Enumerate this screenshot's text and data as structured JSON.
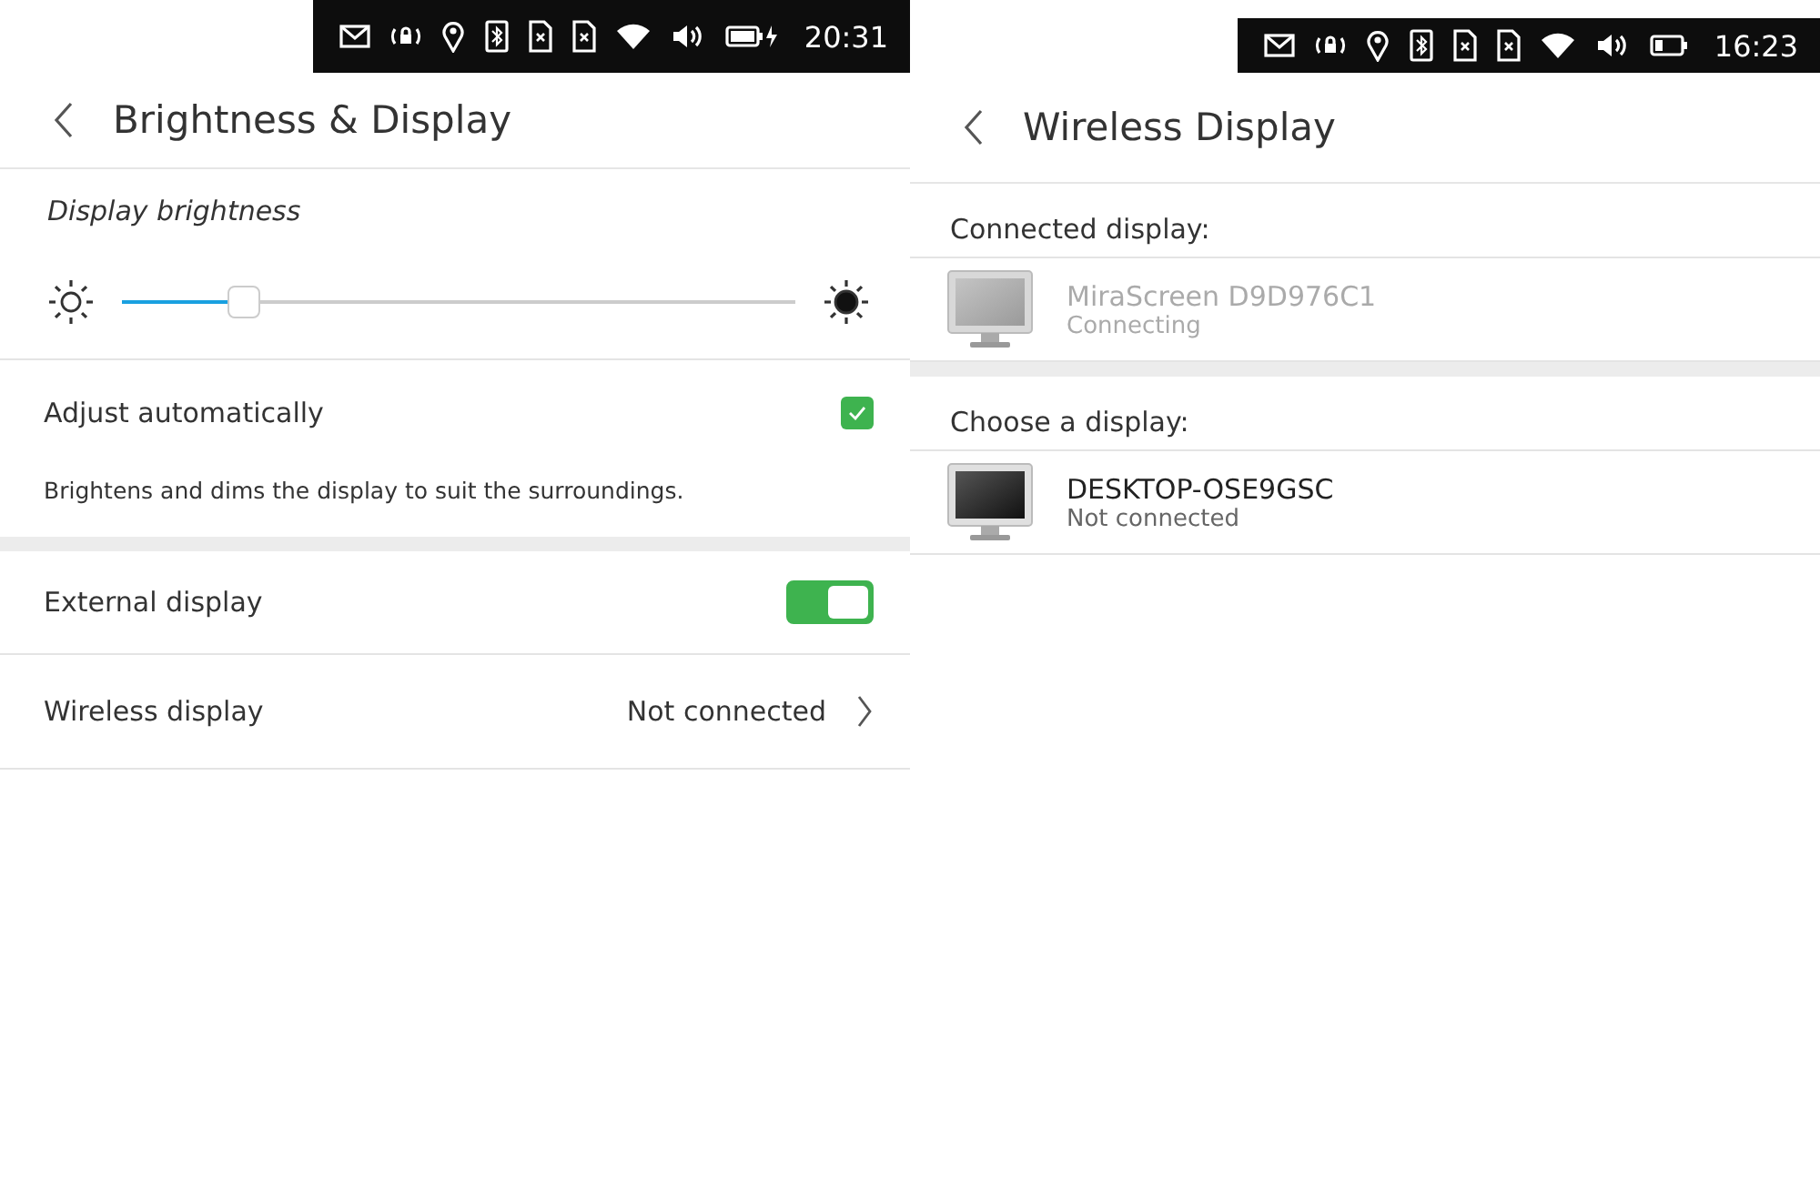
{
  "screens": [
    {
      "kind": "brightness",
      "status_bar": {
        "time": "20:31",
        "charging": true
      },
      "title": "Brightness & Display",
      "brightness": {
        "label": "Display brightness",
        "level": 0.18
      },
      "auto_adjust": {
        "label": "Adjust automatically",
        "checked": true,
        "description": "Brightens and dims the display to suit the surroundings."
      },
      "external_display": {
        "label": "External display",
        "on": true
      },
      "wireless_display": {
        "label": "Wireless display",
        "value": "Not connected"
      }
    },
    {
      "kind": "wireless",
      "status_bar": {
        "time": "16:23",
        "charging": false
      },
      "title": "Wireless Display",
      "sections": [
        {
          "heading": "Connected display:",
          "devices": [
            {
              "name": "MiraScreen D9D976C1",
              "status": "Connecting",
              "disabled": true
            }
          ]
        },
        {
          "heading": "Choose a display:",
          "devices": [
            {
              "name": "DESKTOP-OSE9GSC",
              "status": "Not connected",
              "disabled": false
            }
          ]
        }
      ]
    }
  ]
}
